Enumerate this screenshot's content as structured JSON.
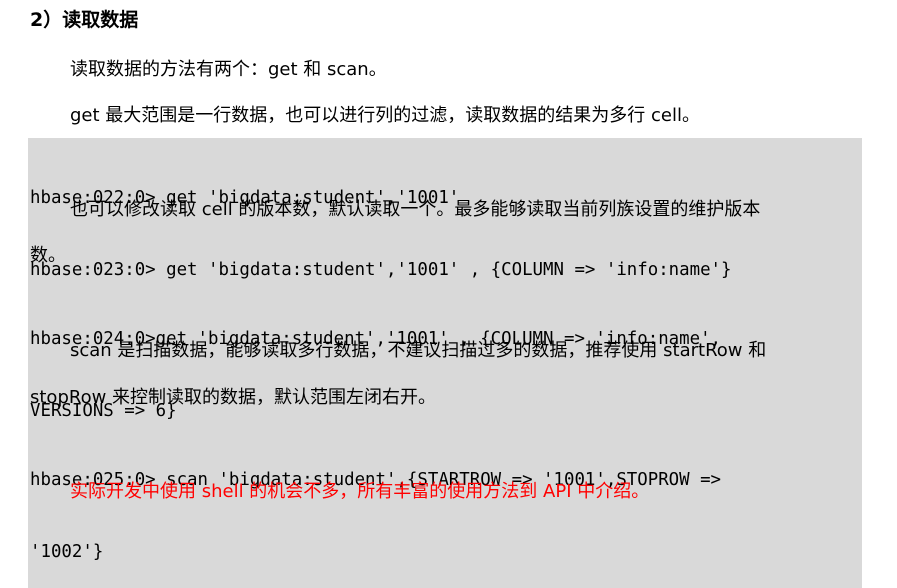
{
  "heading": "2）读取数据",
  "paragraphs": {
    "p1": "读取数据的方法有两个：get 和 scan。",
    "p2": "get 最大范围是一行数据，也可以进行列的过滤，读取数据的结果为多行 cell。",
    "p3_line1": "也可以修改读取 cell 的版本数，默认读取一个。最多能够读取当前列族设置的维护版本",
    "p3_line2": "数。",
    "p4_line1": "scan 是扫描数据，能够读取多行数据，不建议扫描过多的数据，推荐使用 startRow 和",
    "p4_line2": "stopRow 来控制读取的数据，默认范围左闭右开。",
    "p5": "实际开发中使用 shell 的机会不多，所有丰富的使用方法到 API 中介绍。"
  },
  "code_blocks": [
    {
      "lines": [
        "hbase:022:0> get 'bigdata:student','1001'",
        "hbase:023:0> get 'bigdata:student','1001' , {COLUMN => 'info:name'}"
      ]
    },
    {
      "lines": [
        "hbase:024:0>get 'bigdata:student','1001' , {COLUMN => 'info:name',",
        "VERSIONS => 6}"
      ]
    },
    {
      "lines": [
        "hbase:025:0> scan 'bigdata:student',{STARTROW => '1001',STOPROW =>",
        "'1002'}"
      ]
    }
  ],
  "colors": {
    "code_background": "#d9d9d9",
    "emphasis_text": "#ff0000"
  }
}
